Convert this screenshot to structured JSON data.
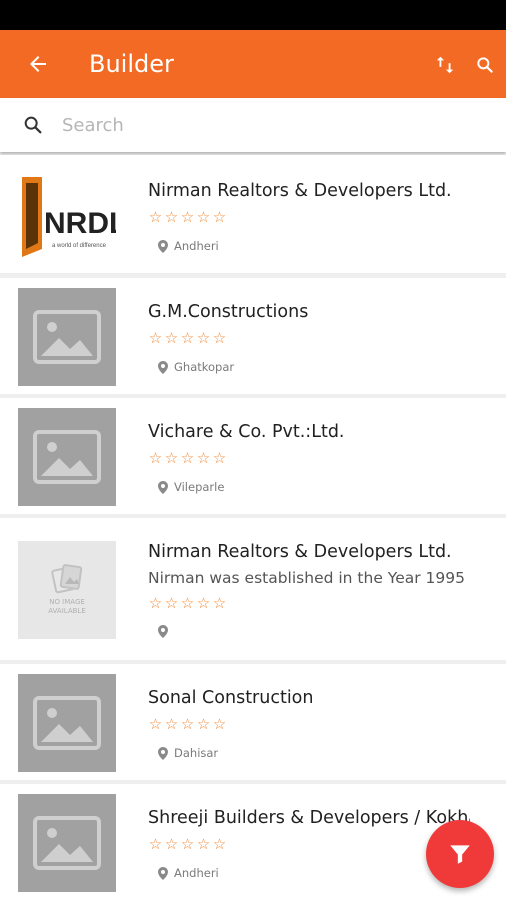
{
  "app_bar": {
    "title": "Builder",
    "back_icon": "arrow-back-icon",
    "swap_icon": "swap-vertical-icon",
    "search_icon": "search-icon",
    "color": "#f26a24"
  },
  "search": {
    "placeholder": "Search",
    "value": ""
  },
  "builders": [
    {
      "name": "Nirman Realtors & Developers Ltd.",
      "description": "",
      "rating": 0,
      "max_rating": 5,
      "location": "Andheri",
      "image": "nrdl-logo",
      "logo_text": "NRDL",
      "logo_tagline": "a world of difference"
    },
    {
      "name": "G.M.Constructions",
      "description": "",
      "rating": 0,
      "max_rating": 5,
      "location": "Ghatkopar",
      "image": "placeholder"
    },
    {
      "name": "Vichare & Co. Pvt.:Ltd.",
      "description": "",
      "rating": 0,
      "max_rating": 5,
      "location": "Vileparle",
      "image": "placeholder"
    },
    {
      "name": "Nirman Realtors & Developers Ltd.",
      "description": "Nirman was established in the Year 1995",
      "rating": 0,
      "max_rating": 5,
      "location": "",
      "image": "no-image",
      "no_image_text": "NO IMAGE AVAILABLE"
    },
    {
      "name": "Sonal Construction",
      "description": "",
      "rating": 0,
      "max_rating": 5,
      "location": "Dahisar",
      "image": "placeholder"
    },
    {
      "name": "Shreeji Builders & Developers / Kokha",
      "description": "",
      "rating": 0,
      "max_rating": 5,
      "location": "Andheri",
      "image": "placeholder"
    }
  ],
  "fab": {
    "icon": "filter-icon",
    "color": "#f03a3a"
  },
  "colors": {
    "star": "#ef8b3c",
    "accent": "#f26a24"
  }
}
